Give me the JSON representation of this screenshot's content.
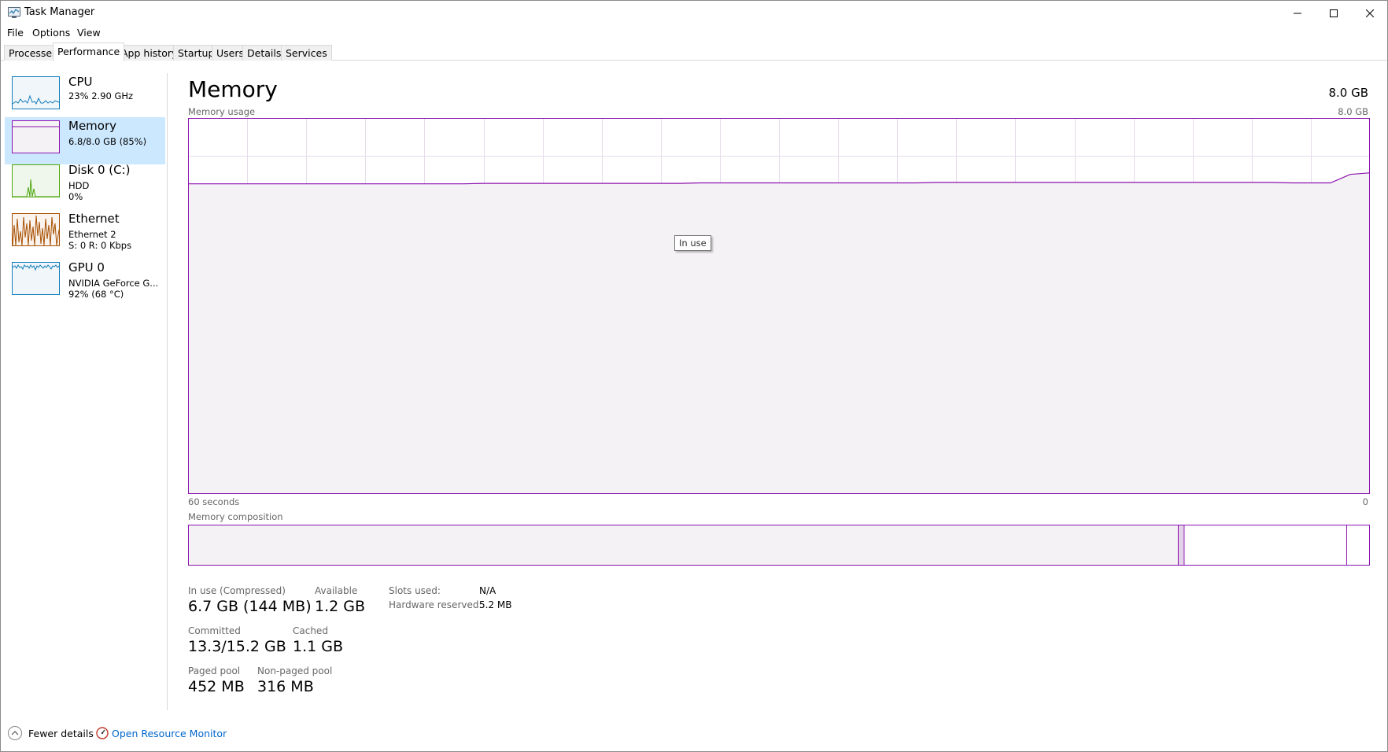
{
  "window": {
    "title": "Task Manager",
    "controls": {
      "minimize": "minimize",
      "maximize": "maximize",
      "close": "close"
    }
  },
  "menu": [
    "File",
    "Options",
    "View"
  ],
  "tabs": [
    "Processes",
    "Performance",
    "App history",
    "Startup",
    "Users",
    "Details",
    "Services"
  ],
  "active_tab": "Performance",
  "sidebar": [
    {
      "title": "CPU",
      "sub1": "23%  2.90 GHz",
      "sub2": "",
      "sub3": "",
      "color": "#117dbb"
    },
    {
      "title": "Memory",
      "sub1": "6.8/8.0 GB (85%)",
      "sub2": "",
      "sub3": "",
      "color": "#8b12ae",
      "active": true
    },
    {
      "title": "Disk 0 (C:)",
      "sub1": "HDD",
      "sub2": "0%",
      "sub3": "",
      "color": "#4da60c"
    },
    {
      "title": "Ethernet",
      "sub1": "Ethernet 2",
      "sub2": "S: 0 R: 0 Kbps",
      "sub3": "",
      "color": "#a74f01"
    },
    {
      "title": "GPU 0",
      "sub1": "NVIDIA GeForce G...",
      "sub2": "92%  (68 °C)",
      "sub3": "",
      "color": "#117dbb"
    }
  ],
  "main": {
    "title": "Memory",
    "total": "8.0 GB",
    "usage_label": "Memory usage",
    "usage_max": "8.0 GB",
    "time_left": "60 seconds",
    "time_right": "0",
    "composition_label": "Memory composition",
    "tooltip": "In use",
    "accent_color": "#8b12ae"
  },
  "stats": {
    "in_use_label": "In use (Compressed)",
    "in_use_value": "6.7 GB (144 MB)",
    "available_label": "Available",
    "available_value": "1.2 GB",
    "committed_label": "Committed",
    "committed_value": "13.3/15.2 GB",
    "cached_label": "Cached",
    "cached_value": "1.1 GB",
    "paged_label": "Paged pool",
    "paged_value": "452 MB",
    "nonpaged_label": "Non-paged pool",
    "nonpaged_value": "316 MB",
    "slots_label": "Slots used:",
    "slots_value": "N/A",
    "hw_reserved_label": "Hardware reserved:",
    "hw_reserved_value": "5.2 MB"
  },
  "footer": {
    "fewer_details": "Fewer details",
    "open_resource_monitor": "Open Resource Monitor"
  },
  "chart_data": {
    "type": "area",
    "title": "Memory usage",
    "xlabel": "60 seconds",
    "ylabel": "",
    "ylim": [
      0,
      8.0
    ],
    "xlim": [
      60,
      0
    ],
    "series": [
      {
        "values": [
          6.6,
          6.6,
          6.6,
          6.6,
          6.6,
          6.6,
          6.6,
          6.6,
          6.6,
          6.6,
          6.6,
          6.6,
          6.6,
          6.6,
          6.6,
          6.61,
          6.61,
          6.61,
          6.61,
          6.61,
          6.61,
          6.61,
          6.61,
          6.61,
          6.61,
          6.61,
          6.62,
          6.62,
          6.62,
          6.62,
          6.62,
          6.62,
          6.62,
          6.62,
          6.62,
          6.62,
          6.62,
          6.62,
          6.63,
          6.63,
          6.63,
          6.63,
          6.63,
          6.63,
          6.63,
          6.63,
          6.63,
          6.63,
          6.63,
          6.63,
          6.63,
          6.63,
          6.63,
          6.63,
          6.63,
          6.63,
          6.62,
          6.62,
          6.62,
          6.8
        ],
        "x": [
          60,
          59,
          58,
          57,
          56,
          55,
          54,
          53,
          52,
          51,
          50,
          49,
          48,
          47,
          46,
          45,
          44,
          43,
          42,
          41,
          40,
          39,
          38,
          37,
          36,
          35,
          34,
          33,
          32,
          31,
          30,
          29,
          28,
          27,
          26,
          25,
          24,
          23,
          22,
          21,
          20,
          19,
          18,
          17,
          16,
          15,
          14,
          13,
          12,
          11,
          10,
          9,
          8,
          7,
          6,
          5,
          4,
          3,
          2,
          1
        ]
      }
    ],
    "composition": {
      "in_use": 6.7,
      "modified": 0.04,
      "standby": 1.1,
      "free": 0.13,
      "total": 8.0
    }
  }
}
